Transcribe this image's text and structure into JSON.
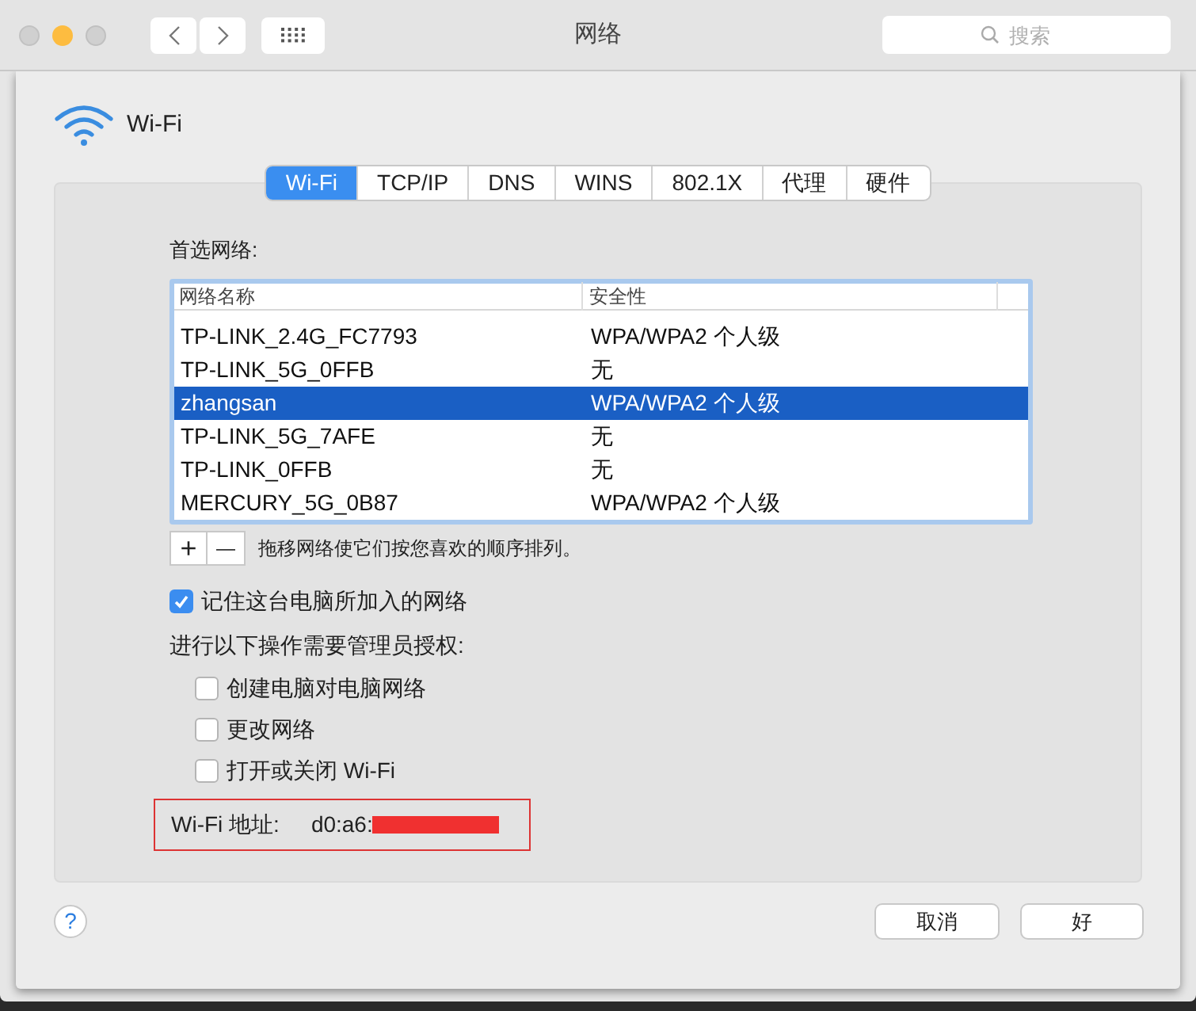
{
  "window": {
    "title": "网络",
    "search": {
      "placeholder": "搜索"
    },
    "traffic_lights": [
      {
        "kind": "close",
        "disabled": true
      },
      {
        "kind": "minimize",
        "disabled": false
      },
      {
        "kind": "zoom",
        "disabled": true
      }
    ]
  },
  "sheet": {
    "title": "Wi-Fi",
    "tabs": [
      {
        "label": "Wi-Fi",
        "selected": true
      },
      {
        "label": "TCP/IP",
        "selected": false
      },
      {
        "label": "DNS",
        "selected": false
      },
      {
        "label": "WINS",
        "selected": false
      },
      {
        "label": "802.1X",
        "selected": false
      },
      {
        "label": "代理",
        "selected": false
      },
      {
        "label": "硬件",
        "selected": false
      }
    ],
    "preferred_label": "首选网络:",
    "table": {
      "columns": [
        "网络名称",
        "安全性"
      ],
      "rows": [
        {
          "name": "TP-LINK_2.4G_FC7793",
          "security": "WPA/WPA2 个人级",
          "selected": false
        },
        {
          "name": "TP-LINK_5G_0FFB",
          "security": "无",
          "selected": false
        },
        {
          "name": "zhangsan",
          "security": "WPA/WPA2 个人级",
          "selected": true
        },
        {
          "name": "TP-LINK_5G_7AFE",
          "security": "无",
          "selected": false
        },
        {
          "name": "TP-LINK_0FFB",
          "security": "无",
          "selected": false
        },
        {
          "name": "MERCURY_5G_0B87",
          "security": "WPA/WPA2 个人级",
          "selected": false
        }
      ]
    },
    "add_button": "+",
    "remove_button": "—",
    "hint": "拖移网络使它们按您喜欢的顺序排列。",
    "remember": {
      "label": "记住这台电脑所加入的网络",
      "checked": true
    },
    "admin_label": "进行以下操作需要管理员授权:",
    "admin_options": [
      {
        "label": "创建电脑对电脑网络",
        "checked": false
      },
      {
        "label": "更改网络",
        "checked": false
      },
      {
        "label": "打开或关闭 Wi-Fi",
        "checked": false
      }
    ],
    "address": {
      "label": "Wi-Fi 地址:",
      "value": "d0:a6:"
    }
  },
  "buttons": {
    "help": "?",
    "cancel": "取消",
    "ok": "好"
  }
}
